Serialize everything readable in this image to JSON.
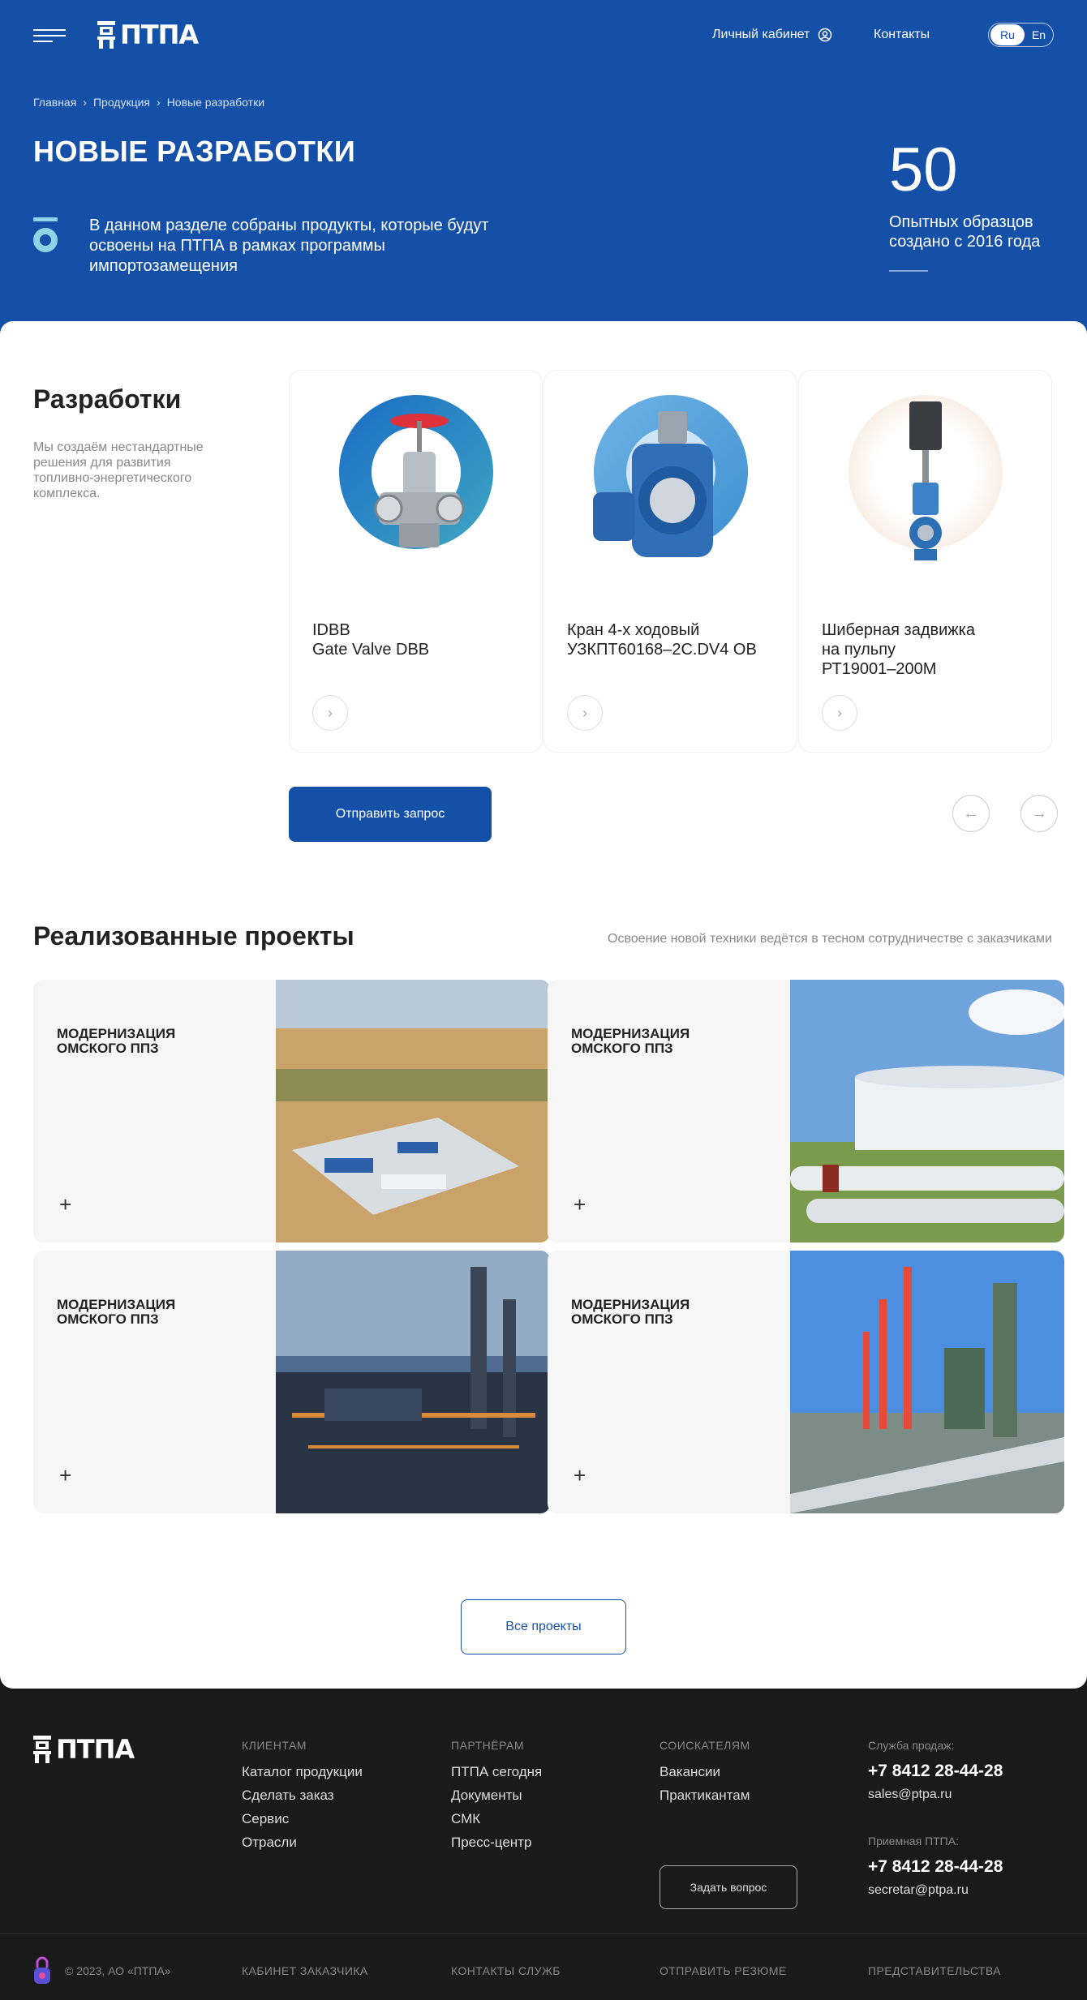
{
  "header": {
    "logo_text": "ПТПА",
    "cabinet_label": "Личный кабинет",
    "contacts_label": "Контакты",
    "lang_ru": "Ru",
    "lang_en": "En"
  },
  "breadcrumb": [
    "Главная",
    "Продукция",
    "Новые разработки"
  ],
  "hero": {
    "title": "НОВЫЕ РАЗРАБОТКИ",
    "description": "В данном разделе собраны продукты, которые будут освоены на ПТПА в рамках программы импортозамещения",
    "stat_value": "50",
    "stat_label": "Опытных образцов создано с 2016 года"
  },
  "developments": {
    "title": "Разработки",
    "description": "Мы создаём нестандартные решения для развития топливно-энергетического комплекса.",
    "cards": [
      {
        "name": "IDBB\nGate Valve DBB",
        "color": "#1a78c8"
      },
      {
        "name": "Кран 4-х ходовый\nУЗКПТ60168–2C.DV4 OB",
        "color": "#5fa8e0"
      },
      {
        "name": "Шиберная задвижка\nна пульпу\nРТ19001–200М",
        "color": "#f3d9c4"
      }
    ],
    "request_button": "Отправить запрос"
  },
  "projects": {
    "title": "Реализованные проекты",
    "subtitle": "Освоение новой техники ведётся в тесном сотрудничестве с заказчиками",
    "items": [
      {
        "label": "МОДЕРНИЗАЦИЯ\nОМСКОГО ППЗ"
      },
      {
        "label": "МОДЕРНИЗАЦИЯ\nОМСКОГО ППЗ"
      },
      {
        "label": "МОДЕРНИЗАЦИЯ\nОМСКОГО ППЗ"
      },
      {
        "label": "МОДЕРНИЗАЦИЯ\nОМСКОГО ППЗ"
      }
    ],
    "all_button": "Все проекты"
  },
  "footer": {
    "logo_text": "ПТПА",
    "columns": [
      {
        "title": "КЛИЕНТАМ",
        "links": [
          "Каталог продукции",
          "Сделать заказ",
          "Сервис",
          "Отрасли"
        ]
      },
      {
        "title": "ПАРТНЁРАМ",
        "links": [
          "ПТПА сегодня",
          "Документы",
          "СМК",
          "Пресс-центр"
        ]
      },
      {
        "title": "СОИСКАТЕЛЯМ",
        "links": [
          "Вакансии",
          "Практикантам"
        ]
      }
    ],
    "ask_button": "Задать вопрос",
    "sales_caption": "Служба продаж:",
    "sales_phone": "+7 8412 28-44-28",
    "sales_email": "sales@ptpa.ru",
    "reception_caption": "Приемная ПТПА:",
    "reception_phone": "+7 8412 28-44-28",
    "reception_email": "secretar@ptpa.ru",
    "copyright": "© 2023, АО «ПТПА»",
    "bottom_links": [
      "КАБИНЕТ ЗАКАЗЧИКА",
      "КОНТАКТЫ СЛУЖБ",
      "ОТПРАВИТЬ РЕЗЮМЕ",
      "ПРЕДСТАВИТЕЛЬСТВА"
    ]
  },
  "colors": {
    "brand_blue": "#1450a8",
    "footer_bg": "#1a1a1a",
    "card_bg": "#f6f6f7"
  }
}
